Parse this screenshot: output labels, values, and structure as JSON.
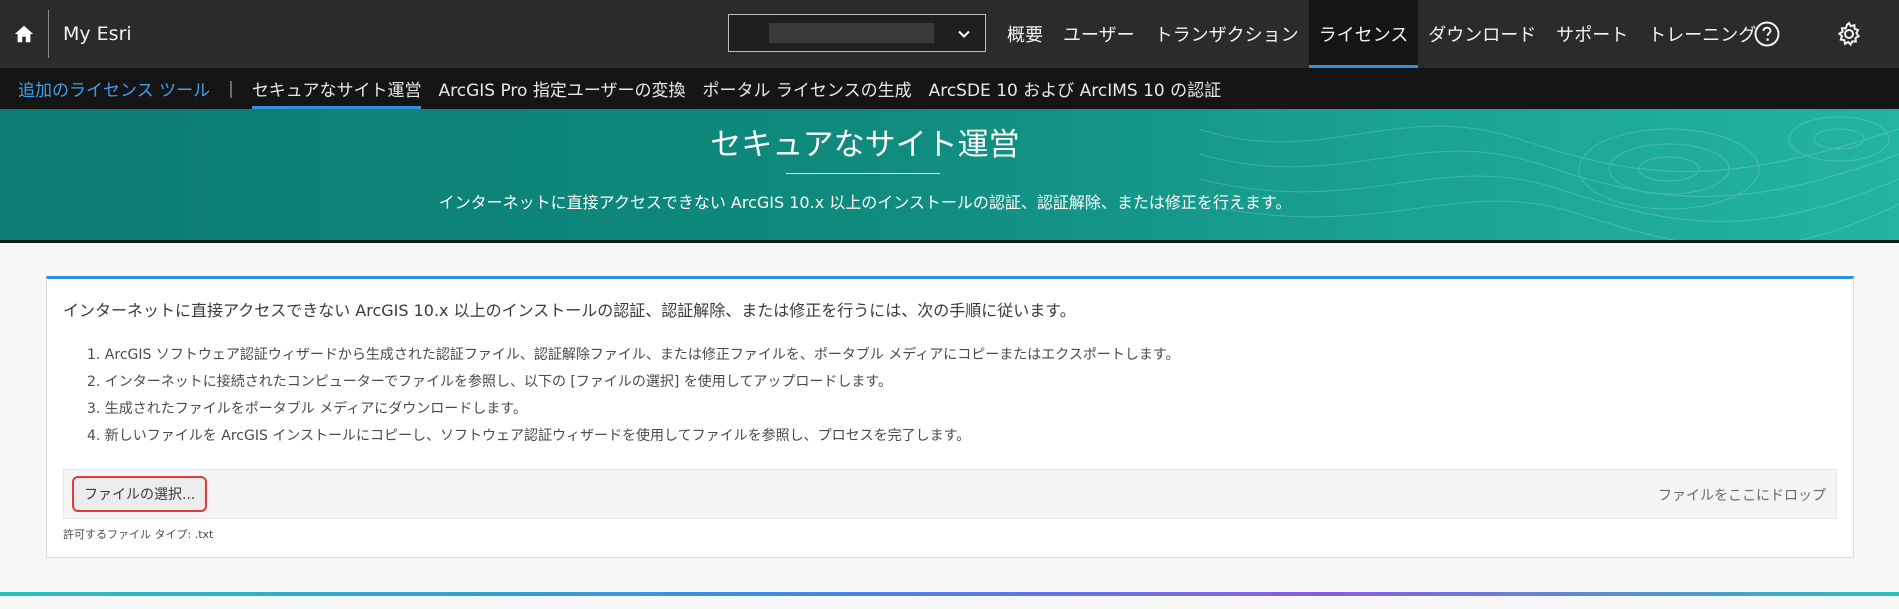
{
  "topbar": {
    "brand": "My Esri",
    "org_selector_value": "",
    "nav": [
      {
        "label": "概要"
      },
      {
        "label": "ユーザー"
      },
      {
        "label": "トランザクション"
      },
      {
        "label": "ライセンス",
        "active": true
      },
      {
        "label": "ダウンロード"
      },
      {
        "label": "サポート"
      },
      {
        "label": "トレーニング"
      }
    ],
    "icons": {
      "home": "home-icon",
      "help": "help-circle-icon",
      "settings": "gear-icon",
      "dropdown": "chevron-down-icon"
    }
  },
  "subnav": {
    "title": "追加のライセンス ツール",
    "separator": "|",
    "links": [
      {
        "label": "セキュアなサイト運営",
        "active": true
      },
      {
        "label": "ArcGIS Pro 指定ユーザーの変換"
      },
      {
        "label": "ポータル ライセンスの生成"
      },
      {
        "label": "ArcSDE 10 および ArcIMS 10 の認証"
      }
    ]
  },
  "hero": {
    "title": "セキュアなサイト運営",
    "subtitle": "インターネットに直接アクセスできない ArcGIS 10.x 以上のインストールの認証、認証解除、または修正を行えます。"
  },
  "card": {
    "intro": "インターネットに直接アクセスできない ArcGIS 10.x 以上のインストールの認証、認証解除、または修正を行うには、次の手順に従います。",
    "steps": [
      "1. ArcGIS ソフトウェア認証ウィザードから生成された認証ファイル、認証解除ファイル、または修正ファイルを、ポータブル メディアにコピーまたはエクスポートします。",
      "2. インターネットに接続されたコンピューターでファイルを参照し、以下の [ファイルの選択] を使用してアップロードします。",
      "3. 生成されたファイルをポータブル メディアにダウンロードします。",
      "4. 新しいファイルを ArcGIS インストールにコピーし、ソフトウェア認証ウィザードを使用してファイルを参照し、プロセスを完了します。"
    ],
    "choose_button": "ファイルの選択...",
    "drop_hint": "ファイルをここにドロップ",
    "allowed_types": "許可するファイル タイプ: .txt"
  },
  "colors": {
    "topbar": "#2b2b2b",
    "subnav": "#151515",
    "accent": "#2f8fe0",
    "hero_start": "#0c7c73",
    "hero_end": "#23b3a2",
    "highlight": "#e53935"
  }
}
